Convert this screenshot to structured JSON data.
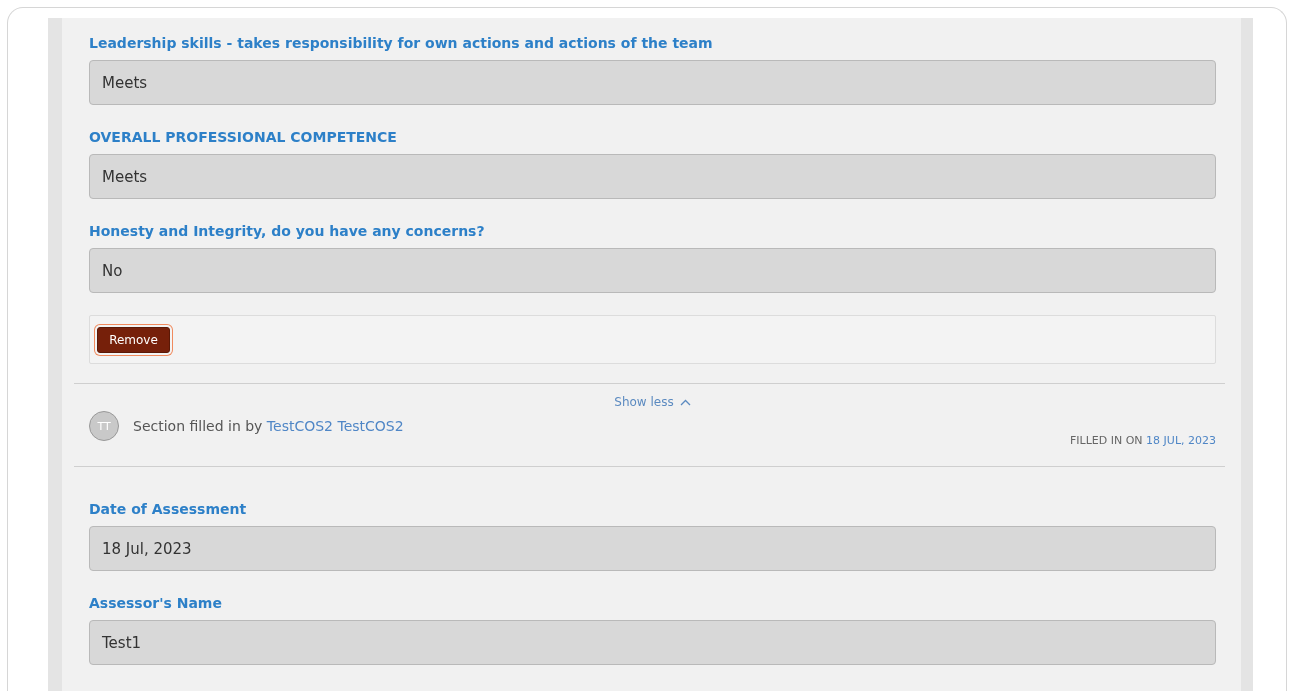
{
  "fields": [
    {
      "label": "Leadership skills - takes responsibility for own actions and actions of the team",
      "value": "Meets"
    },
    {
      "label": "OVERALL PROFESSIONAL COMPETENCE",
      "value": "Meets"
    },
    {
      "label": "Honesty and Integrity, do you have any concerns?",
      "value": "No"
    }
  ],
  "remove_button": {
    "label": "Remove",
    "focused": true
  },
  "toggle": {
    "label": "Show less",
    "expanded": true
  },
  "filled_by": {
    "initials": "TT",
    "text": "Section filled in by",
    "name": "TestCOS2 TestCOS2",
    "date_label": "FILLED IN ON",
    "date": "18 JUL, 2023"
  },
  "more_fields": [
    {
      "label": "Date of Assessment",
      "value": "18 Jul, 2023"
    },
    {
      "label": "Assessor's Name",
      "value": "Test1"
    }
  ]
}
